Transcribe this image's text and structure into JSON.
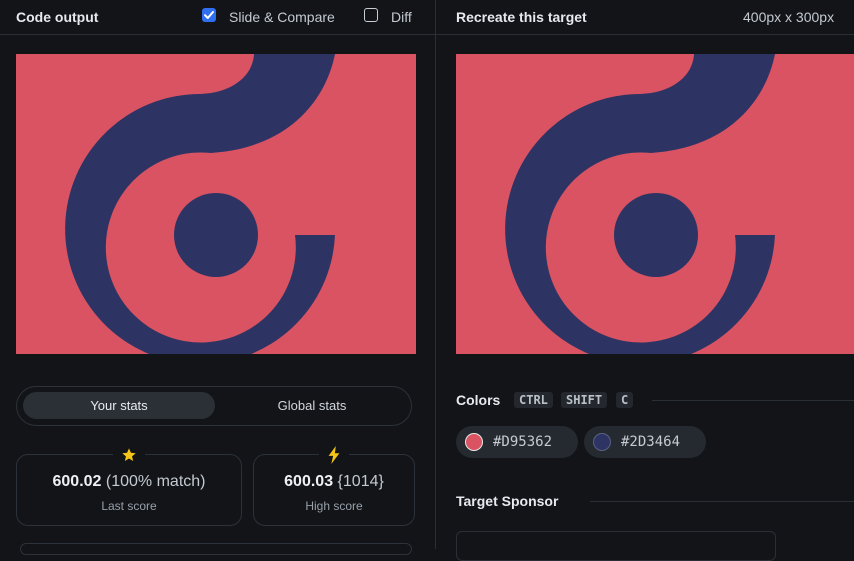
{
  "left_header": {
    "title": "Code output",
    "slide_compare_label": "Slide & Compare",
    "slide_compare_checked": true,
    "diff_label": "Diff",
    "diff_checked": false
  },
  "right_header": {
    "title": "Recreate this target",
    "dimensions": "400px x 300px"
  },
  "stats": {
    "tabs": [
      {
        "label": "Your stats",
        "active": true
      },
      {
        "label": "Global stats",
        "active": false
      }
    ],
    "last": {
      "score": "600.02",
      "detail": "(100% match)",
      "label": "Last score",
      "icon": "star-icon"
    },
    "high": {
      "score": "600.03",
      "detail": "{1014}",
      "label": "High score",
      "icon": "lightning-icon"
    }
  },
  "colors_section": {
    "title": "Colors",
    "shortcut": [
      "CTRL",
      "SHIFT",
      "C"
    ],
    "swatches": [
      {
        "hex": "#D95362"
      },
      {
        "hex": "#2D3464"
      }
    ]
  },
  "sponsor_section": {
    "title": "Target Sponsor"
  },
  "palette": {
    "background": "#D95362",
    "shape": "#2D3464",
    "accent": "#2f6ff0",
    "star": "#f5c518"
  }
}
